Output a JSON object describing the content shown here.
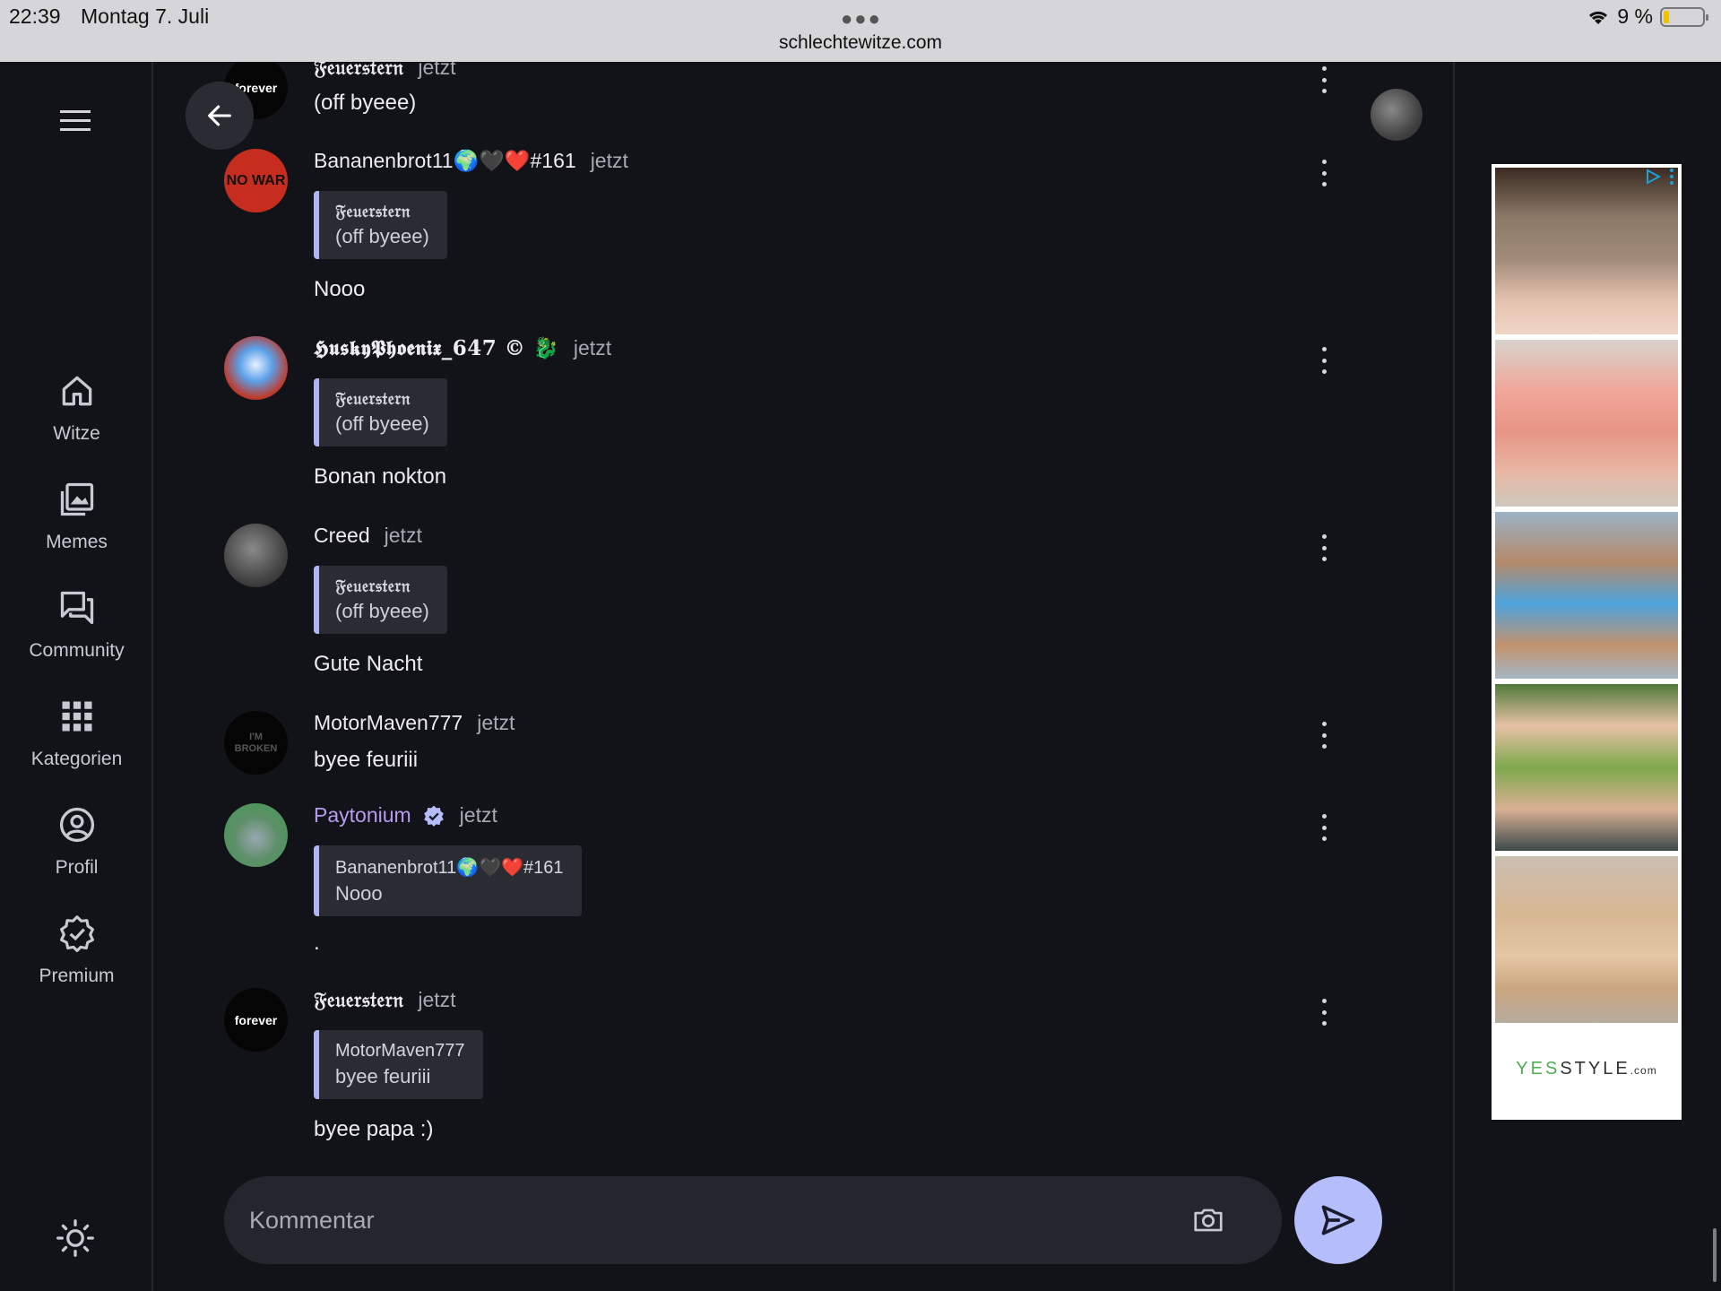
{
  "status": {
    "time": "22:39",
    "date": "Montag 7. Juli",
    "url": "schlechtewitze.com",
    "battery": "9 %"
  },
  "nav": {
    "items": [
      {
        "label": "Witze",
        "icon": "home-icon"
      },
      {
        "label": "Memes",
        "icon": "images-icon"
      },
      {
        "label": "Community",
        "icon": "forum-icon"
      },
      {
        "label": "Kategorien",
        "icon": "grid-icon"
      },
      {
        "label": "Profil",
        "icon": "account-circle-icon"
      },
      {
        "label": "Premium",
        "icon": "verified-badge-icon"
      }
    ]
  },
  "messages": [
    {
      "user": "𝔉𝔢𝔲𝔢𝔯𝔰𝔱𝔢𝔯𝔫",
      "time": "jetzt",
      "text": "(off byeee)",
      "avatar_text": "forever"
    },
    {
      "user": "Bananenbrot11🌍🖤❤️#161",
      "time": "jetzt",
      "quote_author": "𝔉𝔢𝔲𝔢𝔯𝔰𝔱𝔢𝔯𝔫",
      "quote_text": "(off byeee)",
      "text": "Nooo",
      "avatar_text": "NO WAR"
    },
    {
      "user": "𝕳𝖚𝖘𝖐𝖞𝕻𝖍𝖔𝖊𝖓𝖎𝖝_647 © 🐉",
      "time": "jetzt",
      "quote_author": "𝔉𝔢𝔲𝔢𝔯𝔰𝔱𝔢𝔯𝔫",
      "quote_text": "(off byeee)",
      "text": "Bonan nokton"
    },
    {
      "user": "Creed",
      "time": "jetzt",
      "quote_author": "𝔉𝔢𝔲𝔢𝔯𝔰𝔱𝔢𝔯𝔫",
      "quote_text": "(off byeee)",
      "text": "Gute Nacht"
    },
    {
      "user": "MotorMaven777",
      "time": "jetzt",
      "text": "byee feuriii",
      "avatar_text": "I'M BROKEN"
    },
    {
      "user": "Paytonium",
      "time": "jetzt",
      "quote_author": "Bananenbrot11🌍🖤❤️#161",
      "quote_text": "Nooo",
      "text": "."
    },
    {
      "user": "𝔉𝔢𝔲𝔢𝔯𝔰𝔱𝔢𝔯𝔫",
      "time": "jetzt",
      "quote_author": "MotorMaven777",
      "quote_text": "byee feuriii",
      "text": "byee papa :)",
      "avatar_text": "forever"
    }
  ],
  "composer": {
    "placeholder": "Kommentar"
  },
  "ad": {
    "brand_a": "YES",
    "brand_b": "STYLE",
    "brand_c": ".com"
  },
  "colors": {
    "accent": "#b5bdfb",
    "quote_bar": "#aeb6f0",
    "verified_name": "#b89af0",
    "background": "#121318"
  }
}
